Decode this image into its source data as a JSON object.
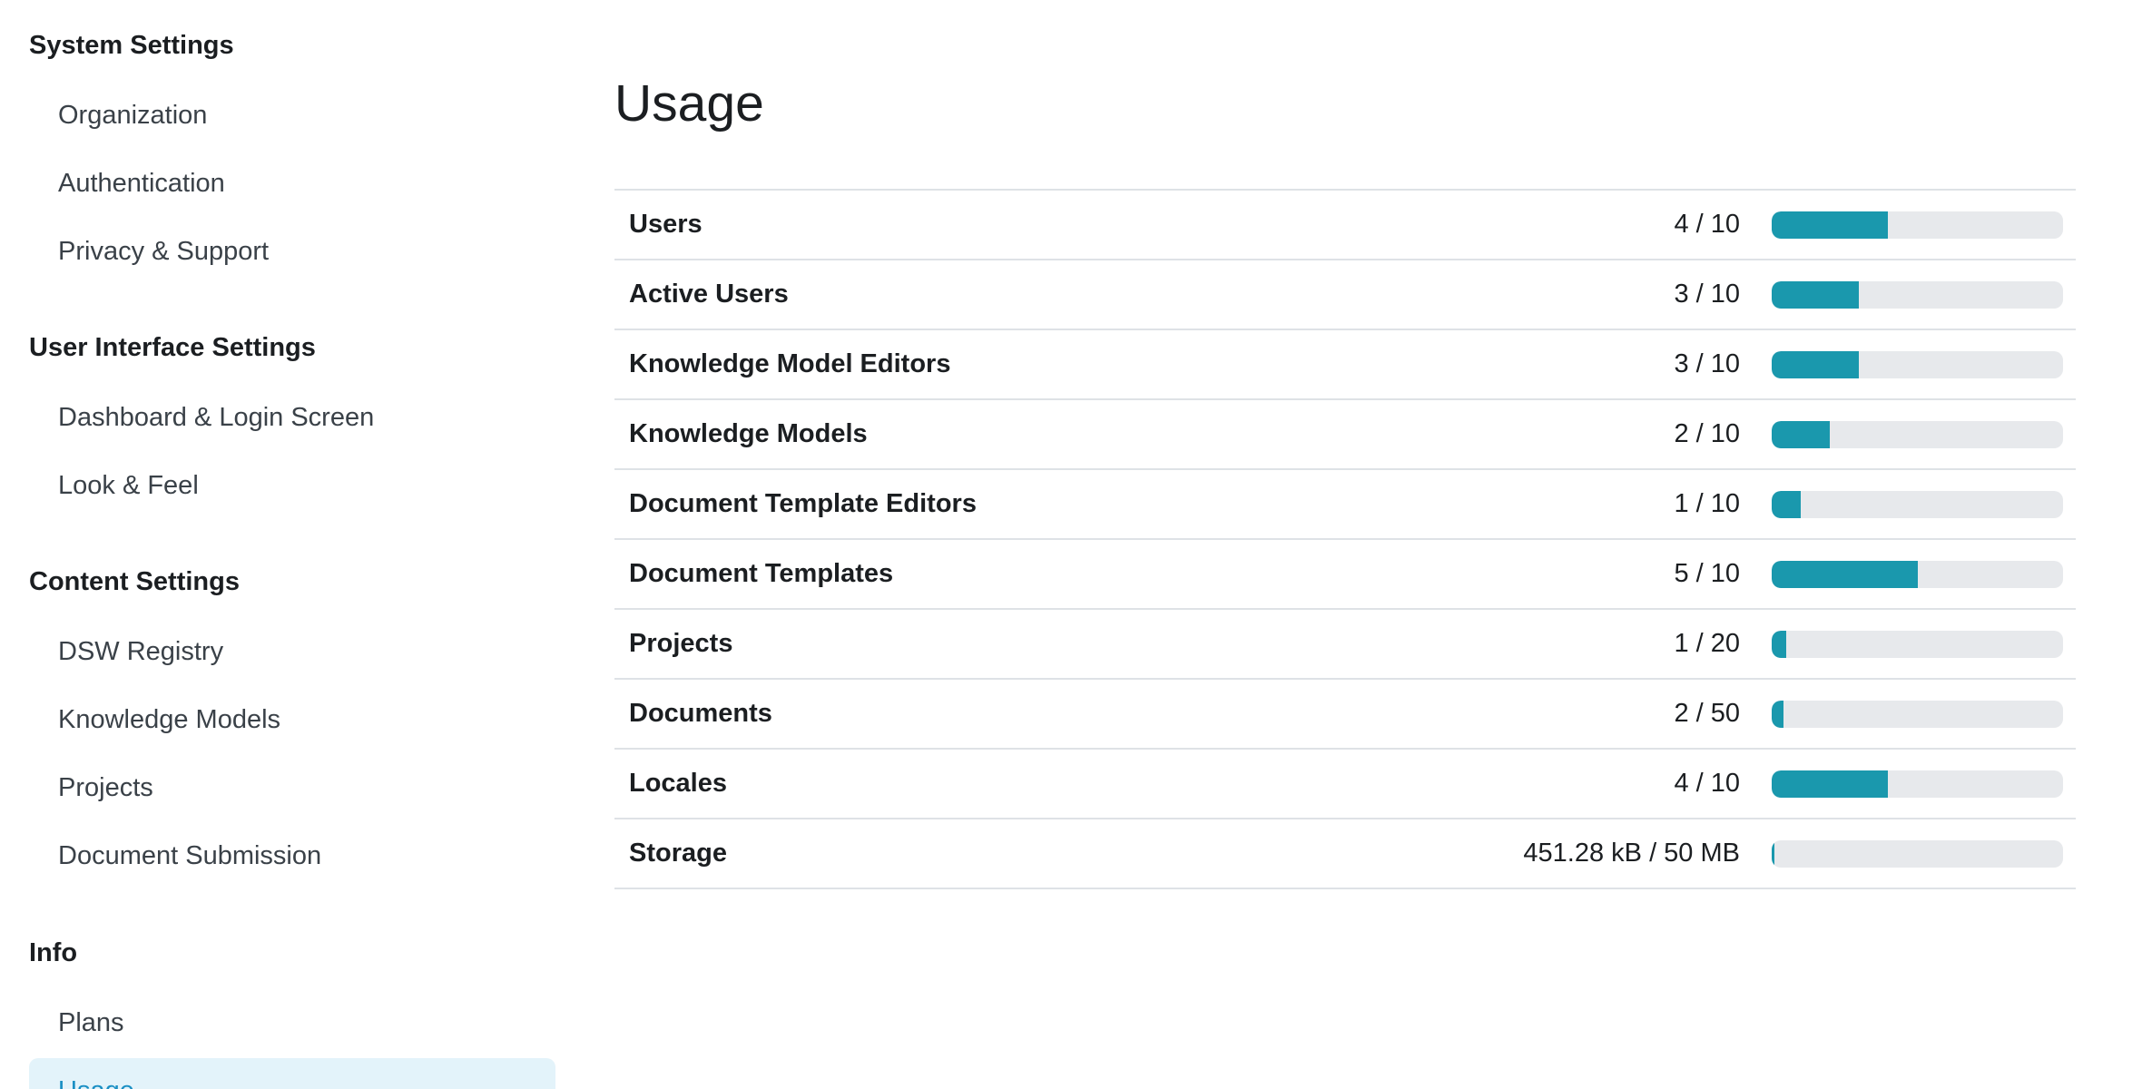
{
  "sidebar": {
    "sections": [
      {
        "title": "System Settings",
        "items": [
          {
            "label": "Organization"
          },
          {
            "label": "Authentication"
          },
          {
            "label": "Privacy & Support"
          }
        ]
      },
      {
        "title": "User Interface Settings",
        "items": [
          {
            "label": "Dashboard & Login Screen"
          },
          {
            "label": "Look & Feel"
          }
        ]
      },
      {
        "title": "Content Settings",
        "items": [
          {
            "label": "DSW Registry"
          },
          {
            "label": "Knowledge Models"
          },
          {
            "label": "Projects"
          },
          {
            "label": "Document Submission"
          }
        ]
      },
      {
        "title": "Info",
        "items": [
          {
            "label": "Plans"
          },
          {
            "label": "Usage",
            "active": true
          }
        ]
      }
    ]
  },
  "main": {
    "title": "Usage",
    "rows": [
      {
        "label": "Users",
        "value": "4 / 10",
        "fraction": 0.4
      },
      {
        "label": "Active Users",
        "value": "3 / 10",
        "fraction": 0.3
      },
      {
        "label": "Knowledge Model Editors",
        "value": "3 / 10",
        "fraction": 0.3
      },
      {
        "label": "Knowledge Models",
        "value": "2 / 10",
        "fraction": 0.2
      },
      {
        "label": "Document Template Editors",
        "value": "1 / 10",
        "fraction": 0.1
      },
      {
        "label": "Document Templates",
        "value": "5 / 10",
        "fraction": 0.5
      },
      {
        "label": "Projects",
        "value": "1 / 20",
        "fraction": 0.05
      },
      {
        "label": "Documents",
        "value": "2 / 50",
        "fraction": 0.04
      },
      {
        "label": "Locales",
        "value": "4 / 10",
        "fraction": 0.4
      },
      {
        "label": "Storage",
        "value": "451.28 kB / 50 MB",
        "fraction": 0.009
      }
    ]
  },
  "colors": {
    "accent": "#1a98ad",
    "progress_track": "#e7e9ec",
    "active_nav_bg": "#e3f3fa",
    "active_nav_text": "#1a8fc4"
  }
}
